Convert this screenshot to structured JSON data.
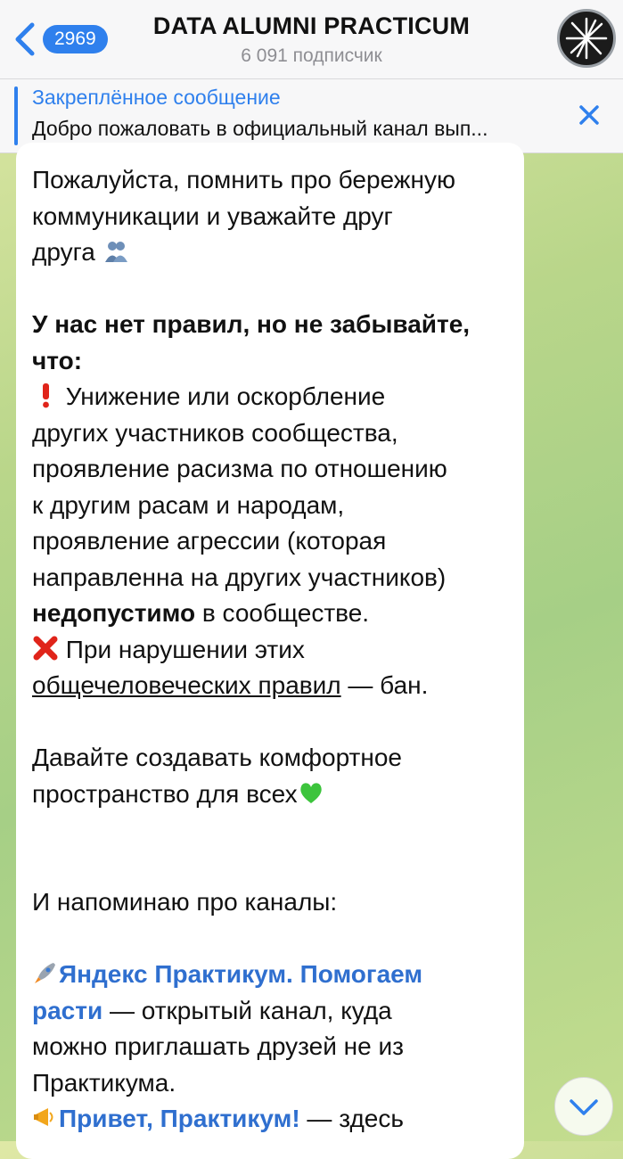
{
  "header": {
    "back_badge": "2969",
    "title": "DATA ALUMNI PRACTICUM",
    "subtitle": "6 091 подписчик"
  },
  "pinned": {
    "title": "Закреплённое сообщение",
    "text": "Добро пожаловать в официальный канал вып..."
  },
  "message": {
    "l1": "Пожалуйста, помнить про бережную",
    "l2": "коммуникации и уважайте друг",
    "l3": "друга",
    "rules_heading_1": "У нас нет правил, но не забывайте,",
    "rules_heading_2": "что:",
    "r1": "Унижение или оскорбление",
    "r2": "других участников сообщества,",
    "r3": "проявление расизма по отношению",
    "r4": "к другим расам и народам,",
    "r5": "проявление агрессии (которая",
    "r6": "направленна на других участников)",
    "r7_bold": "недопустимо",
    "r7_rest": " в сообществе.",
    "ban1": "При нарушении этих",
    "ban2_link": "общечеловеческих правил",
    "ban2_rest": " — бан.",
    "c1": "Давайте создавать комфортное",
    "c2": "пространство для всех",
    "remind": "И напоминаю про каналы:",
    "ch1_link1": "Яндекс Практикум. Помогаем",
    "ch1_link2": "расти",
    "ch1_rest": " — открытый канал, куда",
    "ch1_l2": "можно приглашать друзей не из",
    "ch1_l3": "Практикума.",
    "ch2_link": "Привет, Практикум!",
    "ch2_rest": " — здесь"
  },
  "icons": [
    "back-chevron-icon",
    "channel-avatar",
    "close-icon",
    "hugging-people-emoji",
    "exclamation-emoji",
    "cross-mark-emoji",
    "green-heart-emoji",
    "rocket-emoji",
    "megaphone-emoji",
    "chevron-down-icon"
  ],
  "colors": {
    "accent": "#2f80ed",
    "link": "#2f6fcf",
    "header_bg": "#f7f7f8",
    "chat_bg": "#b9d68a"
  }
}
